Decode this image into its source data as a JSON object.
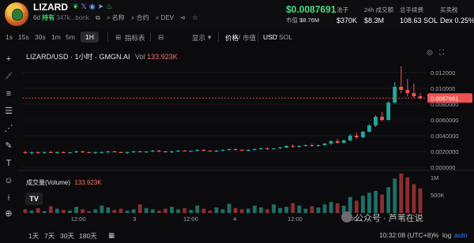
{
  "token": {
    "name": "LIZARD",
    "age": "6d",
    "holders_label": "持有",
    "address": "347k...bonk",
    "links": [
      "名称",
      "合约",
      "DEV"
    ]
  },
  "price": {
    "value": "$0.0087691",
    "mcap_label": "市值",
    "mcap": "$8.76M"
  },
  "stats": [
    {
      "label": "池子",
      "value": "$370K"
    },
    {
      "label": "24h 成交额",
      "value": "$8.3M"
    },
    {
      "label": "总手续费",
      "value": "108.63 SOL"
    },
    {
      "label": "买卖税",
      "value": "Dex 0.25%"
    }
  ],
  "toolbar": {
    "timeframes": [
      "1s",
      "15s",
      "30s",
      "1m",
      "5m",
      "1H"
    ],
    "active": "1H",
    "indicators": "指标表",
    "display": "显示",
    "price_mode": "价格",
    "mcap_mode": "市值",
    "pair": "USD",
    "pair_alt": "SOL"
  },
  "chart_legend": {
    "symbol": "LIZARD/USD · 1小时 · GMGN.AI",
    "vol_label": "Vol",
    "vol_value": "133.923K",
    "volume_title": "成交量(Volume)",
    "volume_value": "133.923K",
    "tv": "TV"
  },
  "bottom": {
    "ranges": [
      "1天",
      "7天",
      "30天",
      "180天"
    ],
    "clock": "10:32:08 (UTC+8)",
    "pct": "%",
    "log": "log",
    "auto": "auto"
  },
  "watermark": "公众号 · 芦苇在说",
  "chart_data": {
    "type": "candlestick",
    "title": "LIZARD/USD · 1小时 · GMGN.AI",
    "y_ticks": [
      "0.012000",
      "0.010000",
      "0.0080000",
      "0.0060000",
      "0.0040000",
      "0.0020000",
      "0.000000"
    ],
    "ylim": [
      0,
      0.0134
    ],
    "last_price_label": "0.0087691",
    "last_price": 0.0087691,
    "volume_axis_ticks": [
      "1M",
      "500K"
    ],
    "x_tick_labels": [
      "12:00",
      "3",
      "12:00",
      "4",
      "12:00",
      "5:00"
    ],
    "candles": [
      {
        "o": 0.0019,
        "h": 0.0021,
        "l": 0.0017,
        "c": 0.0018
      },
      {
        "o": 0.0018,
        "h": 0.002,
        "l": 0.0016,
        "c": 0.0019
      },
      {
        "o": 0.0019,
        "h": 0.002,
        "l": 0.0017,
        "c": 0.0018
      },
      {
        "o": 0.0018,
        "h": 0.002,
        "l": 0.0017,
        "c": 0.0019
      },
      {
        "o": 0.0019,
        "h": 0.0021,
        "l": 0.0018,
        "c": 0.0018
      },
      {
        "o": 0.0018,
        "h": 0.002,
        "l": 0.0017,
        "c": 0.0019
      },
      {
        "o": 0.0019,
        "h": 0.002,
        "l": 0.0018,
        "c": 0.0018
      },
      {
        "o": 0.0018,
        "h": 0.0019,
        "l": 0.0017,
        "c": 0.0019
      },
      {
        "o": 0.0019,
        "h": 0.0021,
        "l": 0.0018,
        "c": 0.002
      },
      {
        "o": 0.002,
        "h": 0.0021,
        "l": 0.0018,
        "c": 0.0019
      },
      {
        "o": 0.0019,
        "h": 0.002,
        "l": 0.0018,
        "c": 0.0018
      },
      {
        "o": 0.0018,
        "h": 0.002,
        "l": 0.0017,
        "c": 0.0019
      },
      {
        "o": 0.0019,
        "h": 0.002,
        "l": 0.0018,
        "c": 0.0019
      },
      {
        "o": 0.0019,
        "h": 0.0021,
        "l": 0.0018,
        "c": 0.002
      },
      {
        "o": 0.002,
        "h": 0.0021,
        "l": 0.0019,
        "c": 0.0019
      },
      {
        "o": 0.0019,
        "h": 0.002,
        "l": 0.0018,
        "c": 0.0018
      },
      {
        "o": 0.0018,
        "h": 0.002,
        "l": 0.0017,
        "c": 0.0019
      },
      {
        "o": 0.0019,
        "h": 0.0021,
        "l": 0.0018,
        "c": 0.002
      },
      {
        "o": 0.002,
        "h": 0.0021,
        "l": 0.0019,
        "c": 0.0019
      },
      {
        "o": 0.0019,
        "h": 0.002,
        "l": 0.0018,
        "c": 0.002
      },
      {
        "o": 0.002,
        "h": 0.0022,
        "l": 0.0019,
        "c": 0.0021
      },
      {
        "o": 0.0021,
        "h": 0.0022,
        "l": 0.0019,
        "c": 0.002
      },
      {
        "o": 0.002,
        "h": 0.0021,
        "l": 0.0019,
        "c": 0.0019
      },
      {
        "o": 0.0019,
        "h": 0.0021,
        "l": 0.0018,
        "c": 0.002
      },
      {
        "o": 0.002,
        "h": 0.0022,
        "l": 0.0019,
        "c": 0.0021
      },
      {
        "o": 0.0021,
        "h": 0.0022,
        "l": 0.002,
        "c": 0.002
      },
      {
        "o": 0.002,
        "h": 0.0021,
        "l": 0.0019,
        "c": 0.0021
      },
      {
        "o": 0.0021,
        "h": 0.0023,
        "l": 0.002,
        "c": 0.0022
      },
      {
        "o": 0.0022,
        "h": 0.0023,
        "l": 0.002,
        "c": 0.0021
      },
      {
        "o": 0.0021,
        "h": 0.0022,
        "l": 0.002,
        "c": 0.002
      },
      {
        "o": 0.002,
        "h": 0.0022,
        "l": 0.0019,
        "c": 0.0021
      },
      {
        "o": 0.0021,
        "h": 0.0023,
        "l": 0.002,
        "c": 0.0022
      },
      {
        "o": 0.0022,
        "h": 0.0024,
        "l": 0.0021,
        "c": 0.0023
      },
      {
        "o": 0.0023,
        "h": 0.0024,
        "l": 0.0021,
        "c": 0.0022
      },
      {
        "o": 0.0022,
        "h": 0.0023,
        "l": 0.0021,
        "c": 0.0021
      },
      {
        "o": 0.0021,
        "h": 0.0023,
        "l": 0.002,
        "c": 0.0022
      },
      {
        "o": 0.0022,
        "h": 0.0024,
        "l": 0.0021,
        "c": 0.0023
      },
      {
        "o": 0.0023,
        "h": 0.0025,
        "l": 0.0022,
        "c": 0.0024
      },
      {
        "o": 0.0024,
        "h": 0.0025,
        "l": 0.0022,
        "c": 0.0023
      },
      {
        "o": 0.0023,
        "h": 0.0024,
        "l": 0.0022,
        "c": 0.0024
      },
      {
        "o": 0.0024,
        "h": 0.0026,
        "l": 0.0023,
        "c": 0.0025
      },
      {
        "o": 0.0025,
        "h": 0.0028,
        "l": 0.0024,
        "c": 0.0027
      },
      {
        "o": 0.0027,
        "h": 0.0029,
        "l": 0.0025,
        "c": 0.0026
      },
      {
        "o": 0.0026,
        "h": 0.0028,
        "l": 0.0025,
        "c": 0.0027
      },
      {
        "o": 0.0027,
        "h": 0.0029,
        "l": 0.0026,
        "c": 0.0028
      },
      {
        "o": 0.0028,
        "h": 0.003,
        "l": 0.0026,
        "c": 0.0027
      },
      {
        "o": 0.0027,
        "h": 0.0029,
        "l": 0.0026,
        "c": 0.0028
      },
      {
        "o": 0.0028,
        "h": 0.0031,
        "l": 0.0027,
        "c": 0.003
      },
      {
        "o": 0.003,
        "h": 0.0034,
        "l": 0.0028,
        "c": 0.0033
      },
      {
        "o": 0.0033,
        "h": 0.0036,
        "l": 0.003,
        "c": 0.0031
      },
      {
        "o": 0.0031,
        "h": 0.0035,
        "l": 0.003,
        "c": 0.0034
      },
      {
        "o": 0.0034,
        "h": 0.0042,
        "l": 0.0033,
        "c": 0.004
      },
      {
        "o": 0.004,
        "h": 0.0044,
        "l": 0.0036,
        "c": 0.0038
      },
      {
        "o": 0.0038,
        "h": 0.0046,
        "l": 0.0037,
        "c": 0.0045
      },
      {
        "o": 0.0045,
        "h": 0.0055,
        "l": 0.0044,
        "c": 0.0053
      },
      {
        "o": 0.0053,
        "h": 0.0066,
        "l": 0.0051,
        "c": 0.0064
      },
      {
        "o": 0.0064,
        "h": 0.007,
        "l": 0.0058,
        "c": 0.006
      },
      {
        "o": 0.006,
        "h": 0.0084,
        "l": 0.0059,
        "c": 0.0082
      },
      {
        "o": 0.0082,
        "h": 0.0108,
        "l": 0.008,
        "c": 0.0102
      },
      {
        "o": 0.0102,
        "h": 0.0128,
        "l": 0.0094,
        "c": 0.0098
      },
      {
        "o": 0.0098,
        "h": 0.0112,
        "l": 0.009,
        "c": 0.0094
      },
      {
        "o": 0.0094,
        "h": 0.0106,
        "l": 0.0088,
        "c": 0.009
      },
      {
        "o": 0.009,
        "h": 0.0094,
        "l": 0.0086,
        "c": 0.0087691
      }
    ],
    "volumes": [
      60,
      40,
      80,
      30,
      110,
      70,
      50,
      40,
      100,
      60,
      30,
      60,
      120,
      90,
      50,
      70,
      40,
      60,
      140,
      80,
      60,
      40,
      70,
      100,
      60,
      80,
      50,
      120,
      70,
      40,
      90,
      60,
      150,
      80,
      60,
      70,
      120,
      90,
      60,
      140,
      80,
      100,
      160,
      120,
      70,
      110,
      90,
      140,
      180,
      160,
      120,
      260,
      200,
      280,
      330,
      360,
      300,
      420,
      560,
      640,
      580,
      470,
      400
    ]
  }
}
